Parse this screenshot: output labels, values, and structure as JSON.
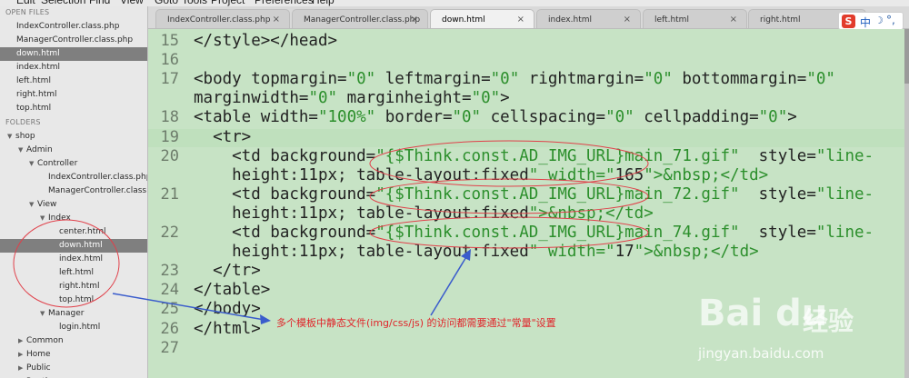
{
  "menu": [
    "Edit",
    "Selection",
    "Find",
    "View",
    "Goto",
    "Tools",
    "Project",
    "Preferences",
    "Help"
  ],
  "sidebar": {
    "open_files_header": "OPEN FILES",
    "open_files": [
      {
        "label": "IndexController.class.php"
      },
      {
        "label": "ManagerController.class.php"
      },
      {
        "label": "down.html",
        "selected": true
      },
      {
        "label": "index.html"
      },
      {
        "label": "left.html"
      },
      {
        "label": "right.html"
      },
      {
        "label": "top.html"
      }
    ],
    "folders_header": "FOLDERS",
    "tree": [
      {
        "label": "shop",
        "depth": 0,
        "arrow": "down"
      },
      {
        "label": "Admin",
        "depth": 1,
        "arrow": "down"
      },
      {
        "label": "Controller",
        "depth": 2,
        "arrow": "down"
      },
      {
        "label": "IndexController.class.php",
        "depth": 3
      },
      {
        "label": "ManagerController.class.php",
        "depth": 3
      },
      {
        "label": "View",
        "depth": 2,
        "arrow": "down"
      },
      {
        "label": "Index",
        "depth": 3,
        "arrow": "down"
      },
      {
        "label": "center.html",
        "depth": 4
      },
      {
        "label": "down.html",
        "depth": 4,
        "selected": true
      },
      {
        "label": "index.html",
        "depth": 4
      },
      {
        "label": "left.html",
        "depth": 4
      },
      {
        "label": "right.html",
        "depth": 4
      },
      {
        "label": "top.html",
        "depth": 4
      },
      {
        "label": "Manager",
        "depth": 3,
        "arrow": "down"
      },
      {
        "label": "login.html",
        "depth": 4
      },
      {
        "label": "Common",
        "depth": 1,
        "arrow": "right"
      },
      {
        "label": "Home",
        "depth": 1,
        "arrow": "right"
      },
      {
        "label": "Public",
        "depth": 1,
        "arrow": "right"
      },
      {
        "label": "Runtime",
        "depth": 1,
        "arrow": "right"
      }
    ]
  },
  "tabs": [
    {
      "label": "IndexController.class.php"
    },
    {
      "label": "ManagerController.class.php"
    },
    {
      "label": "down.html",
      "active": true
    },
    {
      "label": "index.html"
    },
    {
      "label": "left.html"
    },
    {
      "label": "right.html"
    }
  ],
  "tab_close_glyph": "×",
  "ime": {
    "logo": "S",
    "lang": "中",
    "mode": "☽",
    "extra": "°,"
  },
  "editor": {
    "lines": [
      {
        "num": "15",
        "code": "</style></head>"
      },
      {
        "num": "16",
        "code": ""
      },
      {
        "num": "17",
        "code": "<body topmargin=\"0\" leftmargin=\"0\" rightmargin=\"0\" bottommargin=\"0\""
      },
      {
        "num": "",
        "code": "marginwidth=\"0\" marginheight=\"0\">"
      },
      {
        "num": "18",
        "code": "<table width=\"100%\" border=\"0\" cellspacing=\"0\" cellpadding=\"0\">"
      },
      {
        "num": "19",
        "code": "  <tr>"
      },
      {
        "num": "20",
        "code": "    <td background=\"{$Think.const.AD_IMG_URL}main_71.gif\"  style=\"line-"
      },
      {
        "num": "",
        "code": "    height:11px; table-layout:fixed\" width=\"165\">&nbsp;</td>"
      },
      {
        "num": "21",
        "code": "    <td background=\"{$Think.const.AD_IMG_URL}main_72.gif\"  style=\"line-"
      },
      {
        "num": "",
        "code": "    height:11px; table-layout:fixed\">&nbsp;</td>"
      },
      {
        "num": "22",
        "code": "    <td background=\"{$Think.const.AD_IMG_URL}main_74.gif\"  style=\"line-"
      },
      {
        "num": "",
        "code": "    height:11px; table-layout:fixed\" width=\"17\">&nbsp;</td>"
      },
      {
        "num": "23",
        "code": "  </tr>"
      },
      {
        "num": "24",
        "code": "</table>"
      },
      {
        "num": "25",
        "code": "</body>"
      },
      {
        "num": "26",
        "code": "</html>"
      },
      {
        "num": "27",
        "code": ""
      }
    ]
  },
  "annotation": {
    "text": "多个模板中静态文件(img/css/js) 的访问都需要通过\"常量\"设置"
  },
  "watermark": {
    "brand": "Bai du",
    "brand_cn": "经验",
    "url": "jingyan.baidu.com"
  },
  "colors": {
    "editor_bg": "#c7e3c5",
    "string": "#2c8f2c",
    "annotation": "#e0252a",
    "arrow": "#3a5ccc"
  }
}
